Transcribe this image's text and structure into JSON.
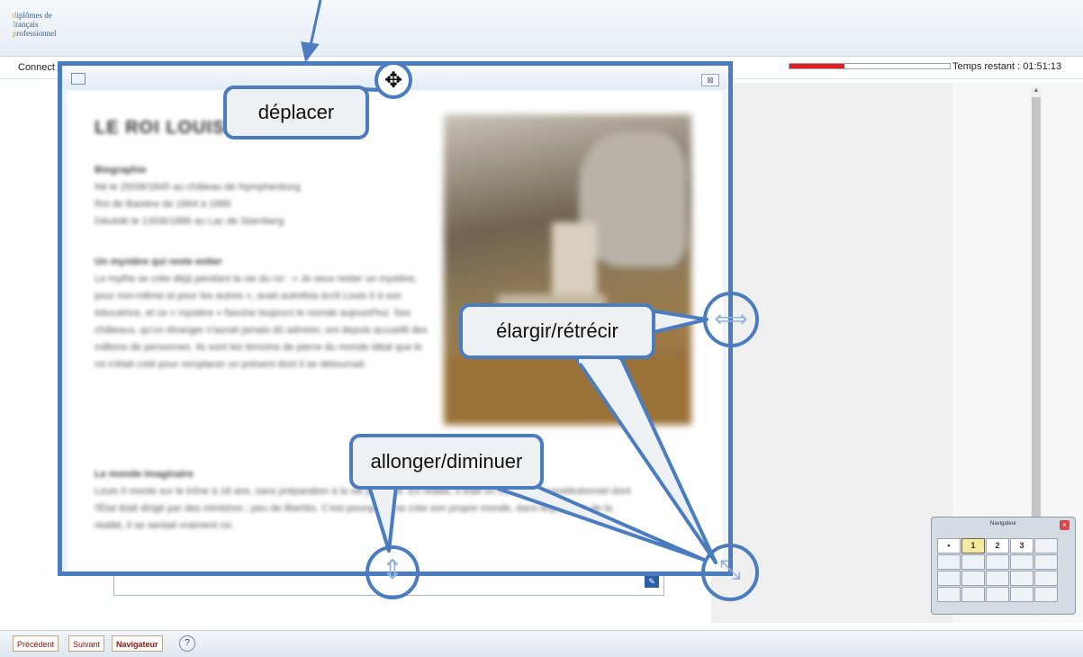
{
  "header": {
    "logo_lines": [
      "diplômes de",
      "français",
      "professionnel"
    ]
  },
  "infobar": {
    "connect_label": "Connect",
    "progress_fraction": 0.34,
    "timer_text": "Temps restant : 01:51:13"
  },
  "doc_window": {
    "close_glyph": "⊠",
    "doc_title": "LE ROI LOUIS II"
  },
  "callouts": {
    "move": "déplacer",
    "width": "élargir/rétrécir",
    "height": "allonger/diminuer"
  },
  "icons": {
    "move": "move-arrows-icon",
    "h_resize": "horizontal-resize-icon",
    "v_resize": "vertical-resize-icon",
    "corner_resize": "diagonal-resize-icon"
  },
  "bottombar": {
    "prev_label": "Précédent",
    "next_label": "Suivant",
    "navigator_label": "Navigateur",
    "help_glyph": "?"
  },
  "navigator": {
    "title": "Navigateur",
    "close_glyph": "×",
    "row1": [
      "•",
      "1",
      "2",
      "3",
      ""
    ],
    "active_page": "1"
  },
  "colors": {
    "accent": "#4a7cbf",
    "progress": "#e02020",
    "nav_text": "#8b1a1a"
  }
}
